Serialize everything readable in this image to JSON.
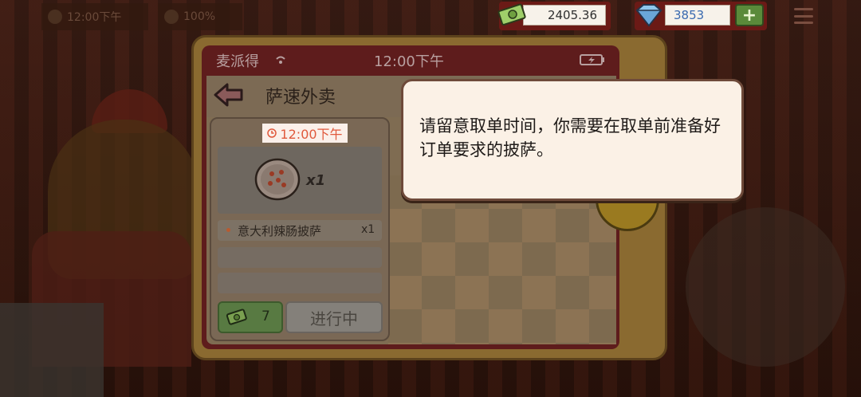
{
  "hud": {
    "time_ghost": "12:00下午",
    "percent_ghost": "100%",
    "money": "2405.36",
    "gems": "3853",
    "add_label": "+"
  },
  "phone": {
    "app_name": "麦派得",
    "time": "12:00下午",
    "page_title": "萨速外卖"
  },
  "order": {
    "due_time": "12:00下午",
    "pizza_qty": "x1",
    "items": [
      {
        "name": "意大利辣肠披萨",
        "qty": "x1"
      }
    ],
    "reward": "7",
    "status": "进行中"
  },
  "tip": {
    "text": "请留意取单时间，你需要在取单前准备好订单要求的披萨。"
  },
  "colors": {
    "accent_red": "#e0593c",
    "reward_green": "#587a42",
    "phone_frame": "#5e1c1c"
  }
}
